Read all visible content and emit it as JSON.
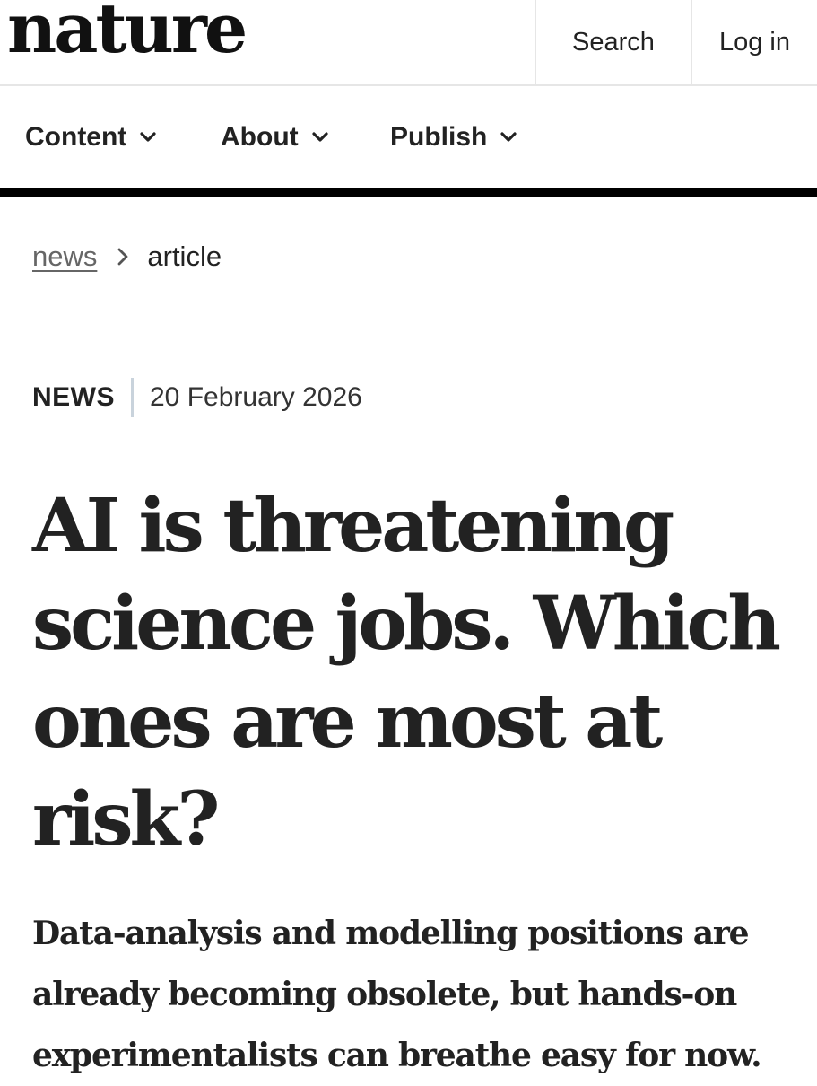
{
  "header": {
    "logo": "nature",
    "search_label": "Search",
    "login_label": "Log in"
  },
  "nav": {
    "items": [
      {
        "label": "Content",
        "icon": "chevron-down-icon"
      },
      {
        "label": "About",
        "icon": "chevron-down-icon"
      },
      {
        "label": "Publish",
        "icon": "chevron-down-icon"
      }
    ]
  },
  "breadcrumb": {
    "items": [
      {
        "label": "news"
      },
      {
        "label": "article"
      }
    ],
    "separator_icon": "chevron-right-icon"
  },
  "article": {
    "type": "NEWS",
    "date": "20 February 2026",
    "title": "AI is threatening science jobs. Which ones are most at risk?",
    "standfirst": "Data-analysis and modelling positions are already becoming obsolete, but hands-on experimentalists can breathe easy for now."
  },
  "colors": {
    "text": "#222222",
    "muted": "#666666",
    "divider": "#c9d3dc",
    "nav_rule": "#000000",
    "border": "#e6e6e6"
  }
}
